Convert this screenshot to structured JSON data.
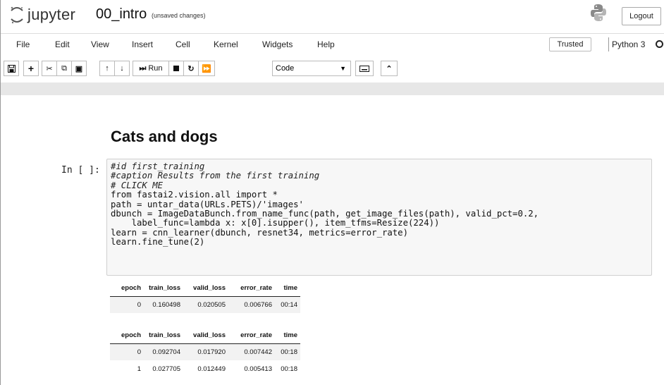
{
  "header": {
    "logo_text": "jupyter",
    "notebook_name": "00_intro",
    "save_status": "(unsaved changes)",
    "logout_label": "Logout"
  },
  "menubar": {
    "items": [
      "File",
      "Edit",
      "View",
      "Insert",
      "Cell",
      "Kernel",
      "Widgets",
      "Help"
    ],
    "trusted_label": "Trusted",
    "kernel_name": "Python 3"
  },
  "toolbar": {
    "run_label": "Run",
    "cell_type": "Code",
    "icons": [
      "save-icon",
      "plus-icon",
      "cut-icon",
      "copy-icon",
      "paste-icon",
      "arrow-up-icon",
      "arrow-down-icon",
      "run-icon",
      "stop-icon",
      "restart-icon",
      "fast-forward-icon",
      "keyboard-icon",
      "chevron-up-icon"
    ]
  },
  "notebook": {
    "heading": "Cats and dogs",
    "prompt": "In [ ]:",
    "code_lines": [
      "#id first_training",
      "#caption Results from the first training",
      "# CLICK ME",
      "from fastai2.vision.all import *",
      "path = untar_data(URLs.PETS)/'images'",
      "dbunch = ImageDataBunch.from_name_func(path, get_image_files(path), valid_pct=0.2,",
      "    label_func=lambda x: x[0].isupper(), item_tfms=Resize(224))",
      "learn = cnn_learner(dbunch, resnet34, metrics=error_rate)",
      "learn.fine_tune(2)"
    ],
    "tables": [
      {
        "headers": [
          "epoch",
          "train_loss",
          "valid_loss",
          "error_rate",
          "time"
        ],
        "rows": [
          [
            "0",
            "0.160498",
            "0.020505",
            "0.006766",
            "00:14"
          ]
        ]
      },
      {
        "headers": [
          "epoch",
          "train_loss",
          "valid_loss",
          "error_rate",
          "time"
        ],
        "rows": [
          [
            "0",
            "0.092704",
            "0.017920",
            "0.007442",
            "00:18"
          ],
          [
            "1",
            "0.027705",
            "0.012449",
            "0.005413",
            "00:18"
          ]
        ]
      }
    ]
  }
}
